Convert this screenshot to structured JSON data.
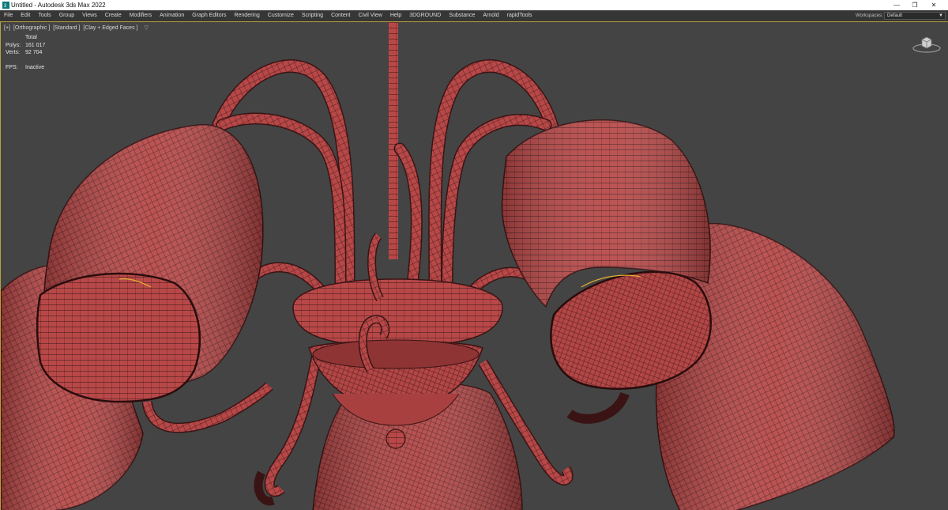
{
  "window": {
    "title": "Untitled - Autodesk 3ds Max 2022"
  },
  "menu": [
    "File",
    "Edit",
    "Tools",
    "Group",
    "Views",
    "Create",
    "Modifiers",
    "Animation",
    "Graph Editors",
    "Rendering",
    "Customize",
    "Scripting",
    "Content",
    "Civil View",
    "Help",
    "3DGROUND",
    "Substance",
    "Arnold",
    "rapidTools"
  ],
  "workspaces": {
    "label": "Workspaces:",
    "value": "Default"
  },
  "viewport": {
    "labels": [
      "[+]",
      "[Orthographic ]",
      "[Standard ]",
      "[Clay + Edged Faces ]"
    ],
    "stats": {
      "header": "Total",
      "polys_label": "Polys:",
      "polys_value": "161 017",
      "verts_label": "Verts:",
      "verts_value": "92 704",
      "fps_label": "FPS:",
      "fps_value": "Inactive"
    }
  },
  "colors": {
    "mesh": "#b84848",
    "wire": "#3a1414",
    "background": "#444444",
    "selection": "#e0b030"
  }
}
